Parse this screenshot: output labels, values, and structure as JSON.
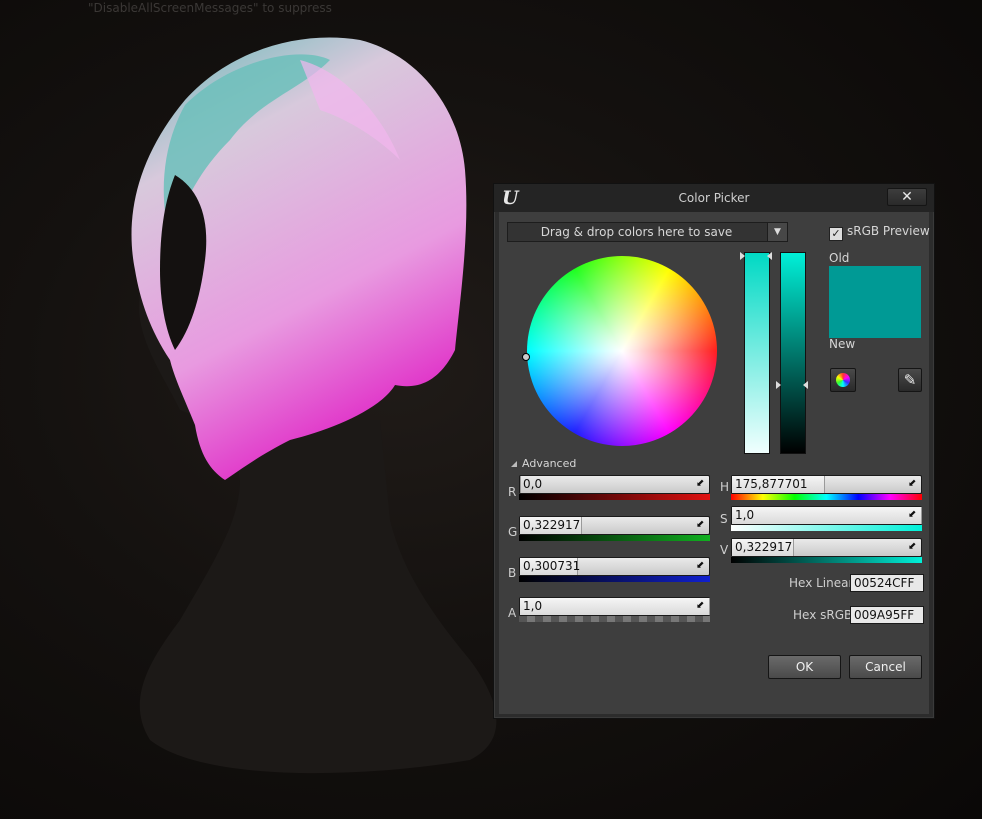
{
  "viewport": {
    "screen_message": "\"DisableAllScreenMessages\" to suppress"
  },
  "picker": {
    "title": "Color Picker",
    "close_label": "✕",
    "swatch_bar_label": "Drag & drop colors here to save",
    "srgb_preview_label": "sRGB Preview",
    "srgb_preview_checked": true,
    "old_label": "Old",
    "new_label": "New",
    "advanced_label": "Advanced",
    "old_color": "#009A95",
    "new_color": "#009A95",
    "channels": {
      "r": {
        "label": "R",
        "value": "0,0",
        "level": 0.0
      },
      "g": {
        "label": "G",
        "value": "0,322917",
        "level": 0.322917
      },
      "b": {
        "label": "B",
        "value": "0,300731",
        "level": 0.300731
      },
      "a": {
        "label": "A",
        "value": "1,0",
        "level": 1.0
      },
      "h": {
        "label": "H",
        "value": "175,877701",
        "level": 0.4885
      },
      "s": {
        "label": "S",
        "value": "1,0",
        "level": 1.0
      },
      "v": {
        "label": "V",
        "value": "0,322917",
        "level": 0.322917
      }
    },
    "hex_linear_label": "Hex Linear",
    "hex_linear_value": "00524CFF",
    "hex_srgb_label": "Hex sRGB",
    "hex_srgb_value": "009A95FF",
    "ok_label": "OK",
    "cancel_label": "Cancel"
  }
}
